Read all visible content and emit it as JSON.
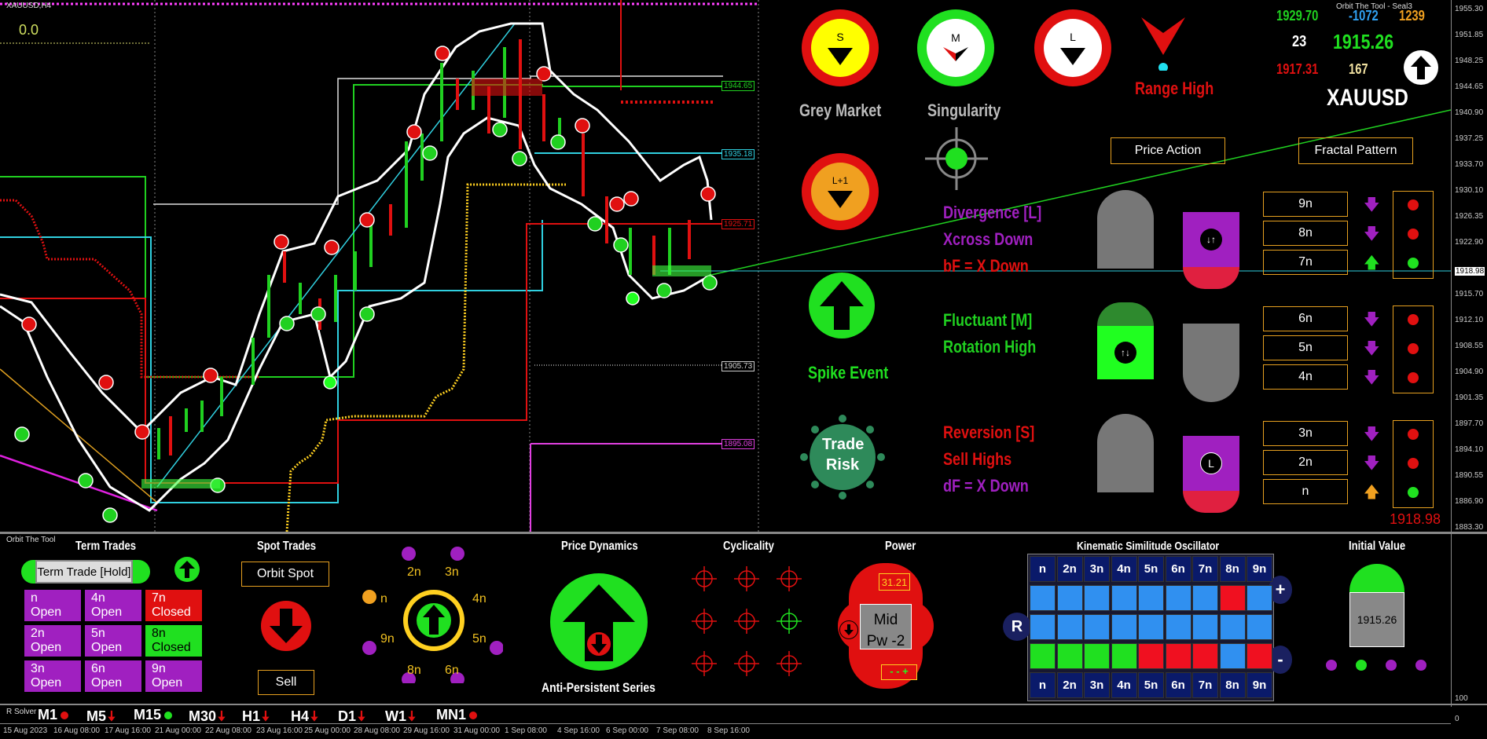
{
  "window": {
    "title": "XAUUSD,H4",
    "indicator_name": "Orbit The Tool - Seal3",
    "value_topleft": "0.0",
    "sub_panel_label": "Orbit The Tool",
    "sub2_panel_label": "R Solver"
  },
  "price_tags": [
    "1944.65",
    "1935.18",
    "1925.71",
    "1905.73",
    "1895.08",
    "1918.98"
  ],
  "price_axis": [
    "1955.30",
    "1951.85",
    "1948.25",
    "1944.65",
    "1940.90",
    "1937.25",
    "1933.70",
    "1930.10",
    "1926.35",
    "1922.90",
    "1918.98",
    "1915.70",
    "1912.10",
    "1908.55",
    "1904.90",
    "1901.35",
    "1897.70",
    "1894.10",
    "1890.55",
    "1886.90",
    "1883.30"
  ],
  "sub_axis": [
    "100",
    "0"
  ],
  "time_axis": [
    "15 Aug 2023",
    "16 Aug 08:00",
    "17 Aug 16:00",
    "21 Aug 00:00",
    "22 Aug 08:00",
    "23 Aug 16:00",
    "25 Aug 00:00",
    "28 Aug 08:00",
    "29 Aug 16:00",
    "31 Aug 00:00",
    "1 Sep 08:00",
    "4 Sep 16:00",
    "6 Sep 00:00",
    "7 Sep 08:00",
    "8 Sep 16:00"
  ],
  "dashboard": {
    "badges": [
      {
        "letter": "S",
        "label": "Grey Market"
      },
      {
        "letter": "M",
        "label": "Singularity"
      },
      {
        "letter": "L",
        "label": ""
      },
      {
        "letter": "L+1",
        "label": ""
      }
    ],
    "range_label": "Range High",
    "spike_label": "Spike Event",
    "trade_risk_label": "Trade Risk",
    "stats": {
      "a": "1929.70",
      "b": "-1072",
      "c": "1239",
      "d": "23",
      "e": "1915.26",
      "f": "1917.31",
      "g": "167"
    },
    "symbol": "XAUUSD",
    "buttons": {
      "price_action": "Price Action",
      "fractal_pattern": "Fractal Pattern"
    },
    "signals": [
      {
        "text": "Divergence [L]",
        "color": "#a020c0"
      },
      {
        "text": "Xcross Down",
        "color": "#a020c0"
      },
      {
        "text": "bF = X Down",
        "color": "#e01010"
      },
      {
        "text": "Fluctuant [M]",
        "color": "#20d020"
      },
      {
        "text": "Rotation High",
        "color": "#20d020"
      },
      {
        "text": "Reversion [S]",
        "color": "#e01010"
      },
      {
        "text": "Sell Highs",
        "color": "#e01010"
      },
      {
        "text": "dF = X Down",
        "color": "#a020c0"
      }
    ],
    "fractals": [
      "9n",
      "8n",
      "7n",
      "6n",
      "5n",
      "4n",
      "3n",
      "2n",
      "n"
    ],
    "fractal_arrows": [
      "down",
      "down",
      "up",
      "down",
      "down",
      "down",
      "down",
      "down",
      "up"
    ],
    "fractal_lights": [
      "red",
      "red",
      "green",
      "red",
      "red",
      "red",
      "red",
      "red",
      "green"
    ],
    "last_price": "1918.98",
    "pill_letter": "L"
  },
  "bottom": {
    "term_trades": {
      "title": "Term Trades",
      "hold_button": "Term Trade [Hold]",
      "cells": [
        {
          "l1": "n",
          "l2": "Open",
          "color": "#a020c0"
        },
        {
          "l1": "4n",
          "l2": "Open",
          "color": "#a020c0"
        },
        {
          "l1": "7n",
          "l2": "Closed",
          "color": "#e01010"
        },
        {
          "l1": "2n",
          "l2": "Open",
          "color": "#a020c0"
        },
        {
          "l1": "5n",
          "l2": "Open",
          "color": "#a020c0"
        },
        {
          "l1": "8n",
          "l2": "Closed",
          "color": "#20d020"
        },
        {
          "l1": "3n",
          "l2": "Open",
          "color": "#a020c0"
        },
        {
          "l1": "6n",
          "l2": "Open",
          "color": "#a020c0"
        },
        {
          "l1": "9n",
          "l2": "Open",
          "color": "#a020c0"
        }
      ]
    },
    "spot_trades": {
      "title": "Spot Trades",
      "orbit_spot": "Orbit Spot",
      "sell": "Sell"
    },
    "orbit_dial": {
      "labels": [
        "2n",
        "3n",
        "n",
        "4n",
        "9n",
        "5n",
        "8n",
        "6n"
      ]
    },
    "price_dynamics": {
      "title": "Price Dynamics",
      "caption": "Anti-Persistent Series"
    },
    "cyclicality": {
      "title": "Cyclicality"
    },
    "power": {
      "title": "Power",
      "value": "31.21",
      "line1": "Mid",
      "line2": "Pw -2",
      "pm": "- - +"
    },
    "kso": {
      "title": "Kinematic Similitude Oscillator",
      "headers": [
        "n",
        "2n",
        "3n",
        "4n",
        "5n",
        "6n",
        "7n",
        "8n",
        "9n"
      ],
      "rows": [
        [
          "b",
          "b",
          "b",
          "b",
          "b",
          "b",
          "b",
          "r",
          "b"
        ],
        [
          "b",
          "b",
          "b",
          "b",
          "b",
          "b",
          "b",
          "b",
          "b"
        ],
        [
          "g",
          "g",
          "g",
          "g",
          "r",
          "r",
          "r",
          "b",
          "r"
        ]
      ],
      "left_btn": "R",
      "plus_btn": "+",
      "minus_btn": "-"
    },
    "initial_value": {
      "title": "Initial Value",
      "value": "1915.26"
    },
    "timeframes": [
      {
        "label": "M1",
        "mark": "dot"
      },
      {
        "label": "M5",
        "mark": "arrow"
      },
      {
        "label": "M15",
        "mark": "dot"
      },
      {
        "label": "M30",
        "mark": "arrow"
      },
      {
        "label": "H1",
        "mark": "arrow"
      },
      {
        "label": "H4",
        "mark": "arrow"
      },
      {
        "label": "D1",
        "mark": "arrow"
      },
      {
        "label": "W1",
        "mark": "arrow"
      },
      {
        "label": "MN1",
        "mark": "dot"
      }
    ]
  }
}
